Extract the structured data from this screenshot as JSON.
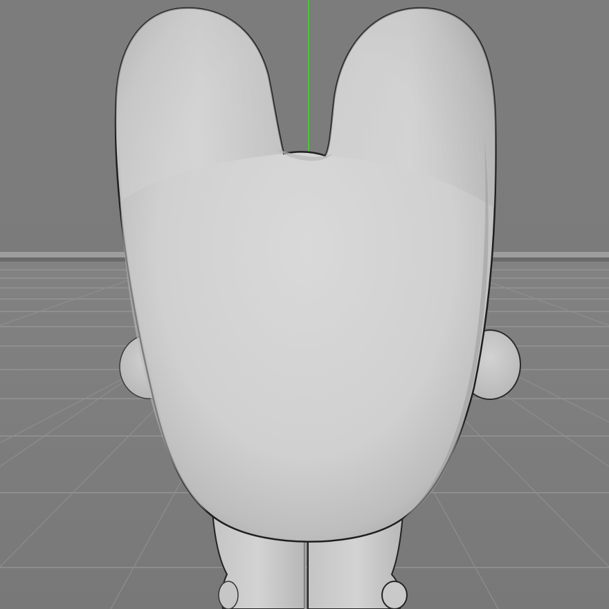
{
  "viewport": {
    "background_color": "#7b7b7b",
    "floor_color": "#7d7d7d",
    "grid_line_color": "#969696",
    "horizon_color": "#9e9e9e",
    "y_axis_color": "#4fc23a",
    "model_color": "#d2d2d2",
    "model_shadow_color": "#a8a8a8",
    "model_outline_color": "#1e1e1e"
  },
  "scene": {
    "view": "perspective",
    "objects": [
      "character-model"
    ],
    "axes_visible": [
      "y-axis"
    ],
    "floor_grid": true
  }
}
